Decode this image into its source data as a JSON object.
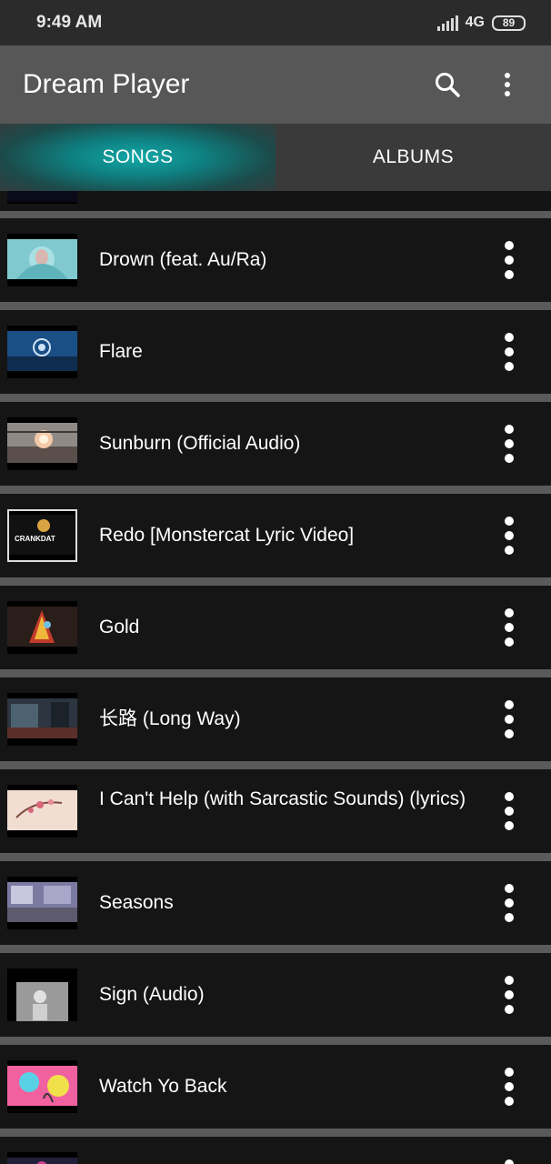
{
  "status": {
    "time": "9:49 AM",
    "network": "4G",
    "battery": "89"
  },
  "app": {
    "title": "Dream Player"
  },
  "toolbar": {
    "search_icon": "search-icon",
    "menu_icon": "more-vert-icon"
  },
  "tabs": [
    {
      "label": "SONGS",
      "active": true
    },
    {
      "label": "ALBUMS",
      "active": false
    }
  ],
  "songs": [
    {
      "title": "Drown (feat. Au/Ra)"
    },
    {
      "title": "Flare"
    },
    {
      "title": "Sunburn (Official Audio)"
    },
    {
      "title": "Redo [Monstercat Lyric Video]"
    },
    {
      "title": "Gold"
    },
    {
      "title": "长路 (Long Way)"
    },
    {
      "title": "I Can't Help (with Sarcastic Sounds) (lyrics)"
    },
    {
      "title": "Seasons"
    },
    {
      "title": "Sign (Audio)"
    },
    {
      "title": "Watch Yo Back"
    }
  ]
}
